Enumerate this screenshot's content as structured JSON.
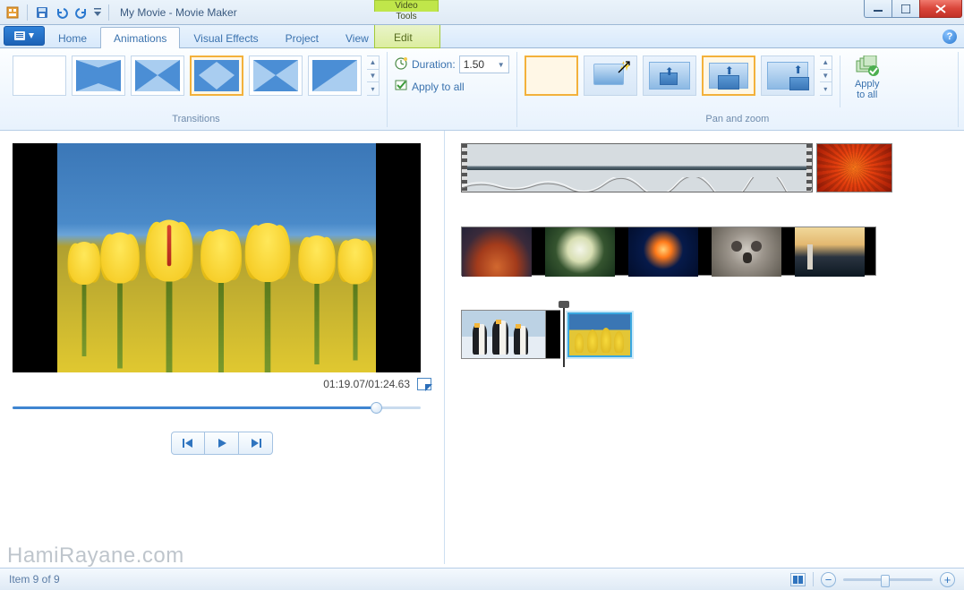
{
  "title": "My Movie - Movie Maker",
  "contextual_tab_header": "Video Tools",
  "tabs": {
    "home": "Home",
    "animations": "Animations",
    "visual_effects": "Visual Effects",
    "project": "Project",
    "view": "View",
    "edit": "Edit"
  },
  "ribbon": {
    "transitions_label": "Transitions",
    "duration_label": "Duration:",
    "duration_value": "1.50",
    "apply_all_label": "Apply to all",
    "pan_label": "Pan and zoom",
    "apply_to_all_big": "Apply\nto all"
  },
  "preview": {
    "time": "01:19.07/01:24.63"
  },
  "status": {
    "item_text": "Item 9 of 9"
  },
  "watermark": "HamiRayane.com"
}
